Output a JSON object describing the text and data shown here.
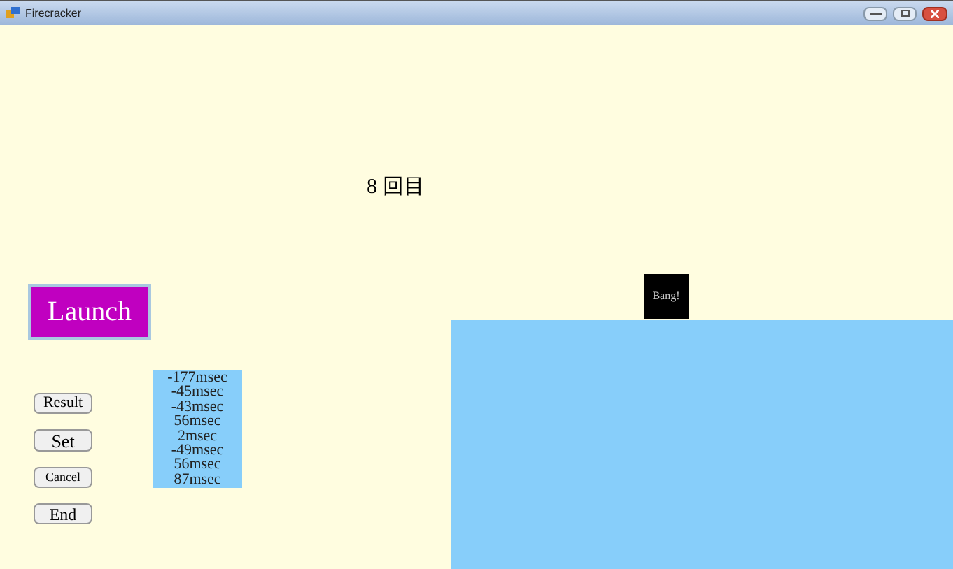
{
  "window": {
    "title": "Firecracker"
  },
  "round_label": "8 回目",
  "launch_button": "Launch",
  "buttons": [
    "Result",
    "Set",
    "Cancel",
    "End"
  ],
  "results": [
    "-177msec",
    "-45msec",
    "-43msec",
    "56msec",
    "2msec",
    "-49msec",
    "56msec",
    "87msec"
  ],
  "bang_label": "Bang!"
}
